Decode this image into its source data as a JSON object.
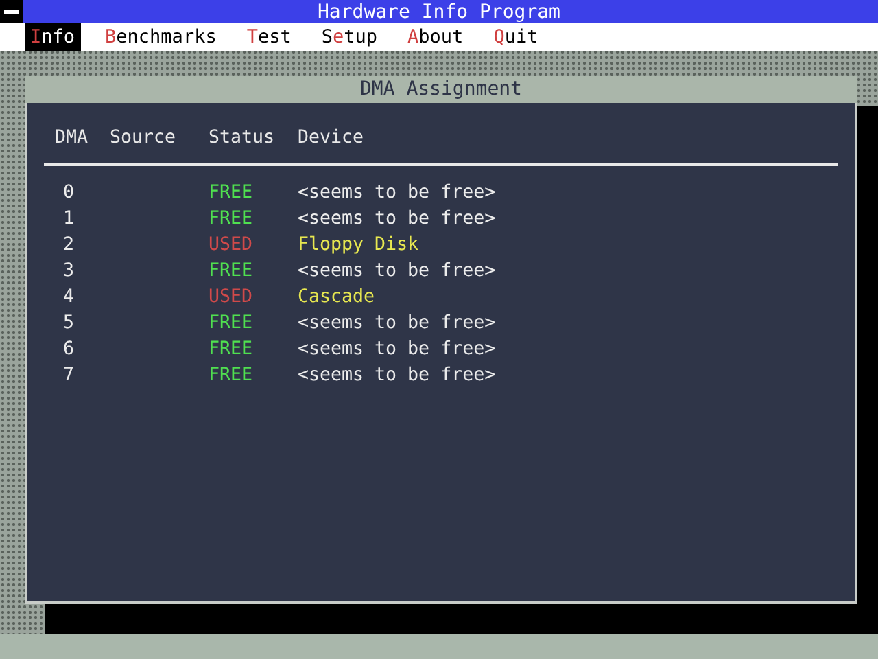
{
  "window": {
    "title": "Hardware Info Program"
  },
  "menu": [
    {
      "hotkey": "I",
      "after": "nfo",
      "selected": true
    },
    {
      "hotkey": "B",
      "after": "enchmarks",
      "selected": false
    },
    {
      "hotkey": "T",
      "after": "est",
      "selected": false
    },
    {
      "before": "S",
      "hotkey": "e",
      "after": "tup",
      "selected": false
    },
    {
      "hotkey": "A",
      "after": "bout",
      "selected": false
    },
    {
      "hotkey": "Q",
      "after": "uit",
      "selected": false
    }
  ],
  "dialog": {
    "title": "DMA Assignment",
    "columns": [
      "DMA",
      "Source",
      "Status",
      "Device"
    ],
    "rows": [
      {
        "dma": "0",
        "status": "FREE",
        "kind": "free",
        "device": "<seems to be free>"
      },
      {
        "dma": "1",
        "status": "FREE",
        "kind": "free",
        "device": "<seems to be free>"
      },
      {
        "dma": "2",
        "status": "USED",
        "kind": "used",
        "device": "Floppy Disk"
      },
      {
        "dma": "3",
        "status": "FREE",
        "kind": "free",
        "device": "<seems to be free>"
      },
      {
        "dma": "4",
        "status": "USED",
        "kind": "used",
        "device": "Cascade"
      },
      {
        "dma": "5",
        "status": "FREE",
        "kind": "free",
        "device": "<seems to be free>"
      },
      {
        "dma": "6",
        "status": "FREE",
        "kind": "free",
        "device": "<seems to be free>"
      },
      {
        "dma": "7",
        "status": "FREE",
        "kind": "free",
        "device": "<seems to be free>"
      }
    ]
  }
}
